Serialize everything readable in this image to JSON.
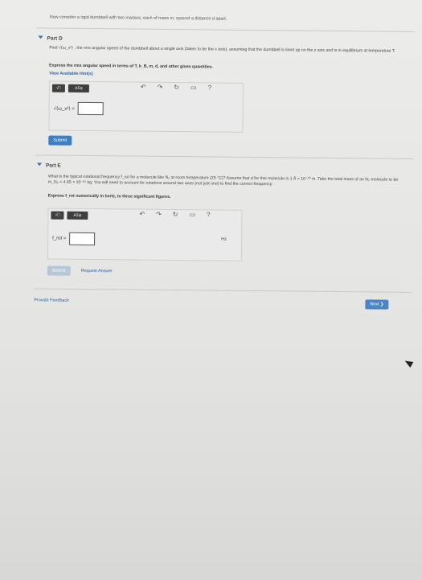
{
  "intro": "Now consider a rigid dumbbell with two masses, each of mass m, spaced a distance d apart.",
  "partD": {
    "header": "Part D",
    "question": "Find √⟨ω_x²⟩ , the rms angular speed of the dumbbell about a single axis (taken to be the x axis), assuming that the dumbbell is lined up on the z axis and is in equilibrium at temperature T.",
    "instruction": "Express the rms angular speed in terms of T, k_B, m, d, and other given quantities.",
    "hints": "View Available Hint(s)",
    "answer_label": "√⟨ω_x²⟩ =",
    "submit": "Submit"
  },
  "partE": {
    "header": "Part E",
    "question": "What is the typical rotational frequency f_rot for a molecule like N₂ at room temperature (25 °C)? Assume that d for this molecule is 1 Å = 10⁻¹⁰ m. Take the total mass of an N₂ molecule to be m_N₂ = 4.65 × 10⁻²⁶ kg. You will need to account for rotations around two axes (not just one) to find the correct frequency.",
    "instruction": "Express f_rot numerically in hertz, to three significant figures.",
    "answer_label": "f_rot =",
    "unit": "Hz",
    "submit": "Submit",
    "request": "Request Answer"
  },
  "toolbar": {
    "templates": "√□",
    "symbols": "ΑΣφ"
  },
  "footer": {
    "feedback": "Provide Feedback",
    "next": "Next ❯"
  }
}
